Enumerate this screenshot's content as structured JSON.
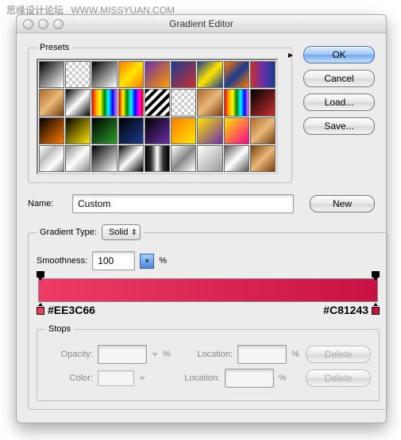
{
  "watermark": {
    "cn": "思缘设计论坛",
    "url": "WWW.MISSYUAN.COM"
  },
  "window": {
    "title": "Gradient Editor"
  },
  "presets": {
    "legend": "Presets"
  },
  "buttons": {
    "ok": "OK",
    "cancel": "Cancel",
    "load": "Load...",
    "save": "Save...",
    "new": "New"
  },
  "name": {
    "label": "Name:",
    "value": "Custom"
  },
  "gradient_type": {
    "label": "Gradient Type:",
    "value": "Solid"
  },
  "smoothness": {
    "label": "Smoothness:",
    "value": "100",
    "unit": "%"
  },
  "gradient": {
    "left_hex": "#EE3C66",
    "right_hex": "#C81243"
  },
  "stops": {
    "legend": "Stops",
    "opacity_label": "Opacity:",
    "color_label": "Color:",
    "location_label": "Location:",
    "unit": "%",
    "delete_label": "Delete"
  }
}
